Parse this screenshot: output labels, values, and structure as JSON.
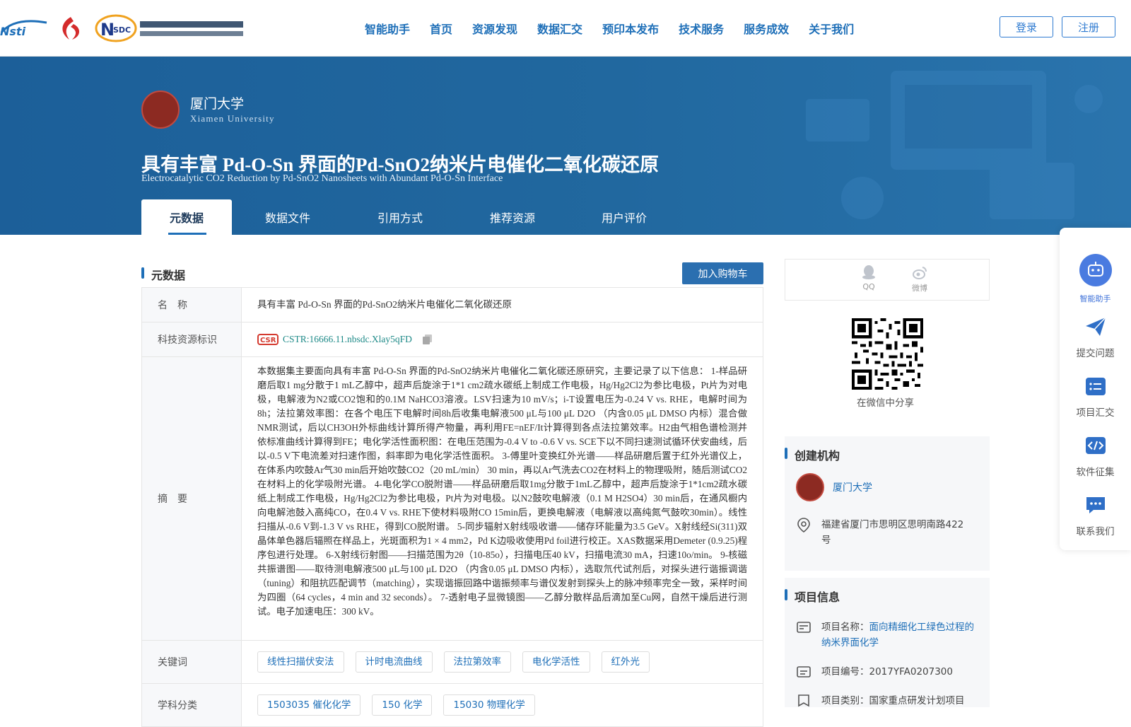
{
  "nav": {
    "items": [
      "智能助手",
      "首页",
      "资源发现",
      "数据汇交",
      "预印本发布",
      "技术服务",
      "服务成效",
      "关于我们"
    ],
    "login": "登录",
    "register": "注册"
  },
  "banner": {
    "institution": "厦门大学",
    "institution_en": "Xiamen University",
    "title": "具有丰富 Pd-O-Sn 界面的Pd-SnO2纳米片电催化二氧化碳还原",
    "subtitle": "Electrocatalytic CO2 Reduction by Pd-SnO2 Nanosheets with Abundant Pd-O-Sn Interface",
    "tabs": [
      "元数据",
      "数据文件",
      "引用方式",
      "推荐资源",
      "用户评价"
    ]
  },
  "metadata": {
    "heading": "元数据",
    "cart_button": "加入购物车",
    "name_label": "名　称",
    "name_value": "具有丰富 Pd-O-Sn 界面的Pd-SnO2纳米片电催化二氧化碳还原",
    "id_label": "科技资源标识",
    "cstr": "CSTR:16666.11.nbsdc.Xlay5qFD",
    "abstract_label": "摘　要",
    "abstract": "本数据集主要面向具有丰富 Pd-O-Sn 界面的Pd-SnO2纳米片电催化二氧化碳还原研究，主要记录了以下信息： 1-样品研磨后取1 mg分散于1 mL乙醇中，超声后旋涂于1*1 cm2疏水碳纸上制成工作电极，Hg/Hg2Cl2为参比电极，Pt片为对电极，电解液为N2或CO2饱和的0.1M NaHCO3溶液。LSV扫速为10 mV/s；i-T设置电压为-0.24 V vs. RHE，电解时间为8h；法拉第效率图：在各个电压下电解时间8h后收集电解液500 μL与100 μL D2O （内含0.05 μL DMSO 内标）混合做NMR测试，后以CH3OH外标曲线计算所得产物量，再利用FE=nEF/It计算得到各点法拉第效率。H2由气相色谱检测并依标准曲线计算得到FE；电化学活性面积图：在电压范围为-0.4 V to -0.6 V vs. SCE下以不同扫速测试循环伏安曲线，后以-0.5 V下电流差对扫速作图，斜率即为电化学活性面积。 3-傅里叶变换红外光谱——样品研磨后置于红外光谱仪上，在体系内吹鼓Ar气30 min后开始吹鼓CO2（20 mL/min） 30 min，再以Ar气洗去CO2在材料上的物理吸附，随后测试CO2在材料上的化学吸附光谱。 4-电化学CO脱附谱——样品研磨后取1mg分散于1mL乙醇中，超声后旋涂于1*1cm2疏水碳纸上制成工作电极，Hg/Hg2Cl2为参比电极，Pt片为对电极。以N2鼓吹电解液（0.1 M H2SO4）30 min后，在通风橱内向电解池鼓入高纯CO，在0.4 V vs. RHE下使材料吸附CO 15min后，更换电解液（电解液以高纯氮气鼓吹30min）。线性扫描从-0.6 V到-1.3 V vs RHE，得到CO脱附谱。 5-同步辐射X射线吸收谱——储存环能量为3.5 GeV。X射线经Si(311)双晶体单色器后辐照在样品上，光斑面积为1 × 4 mm2，Pd K边吸收使用Pd foil进行校正。XAS数据采用Demeter (0.9.25)程序包进行处理。 6-X射线衍射图——扫描范围为2θ（10-85o），扫描电压40 kV，扫描电流30 mA，扫速10o/min。 9-核磁共振谱图——取待测电解液500 μL与100 μL D2O （内含0.05 μL DMSO 内标），选取氘代试剂后，对探头进行谐振调谐（tuning）和阻抗匹配调节（matching），实现谐振回路中谐振频率与谱仪发射到探头上的脉冲频率完全一致，采样时间为四圈（64 cycles，4 min and 32 seconds）。 7-透射电子显微镜图——乙醇分散样品后滴加至Cu网，自然干燥后进行测试。电子加速电压：300 kV。",
    "keywords_label": "关键词",
    "keywords": [
      "线性扫描伏安法",
      "计时电流曲线",
      "法拉第效率",
      "电化学活性",
      "红外光"
    ],
    "subject_label": "学科分类",
    "subjects": [
      "1503035 催化化学",
      "150 化学",
      "15030 物理化学"
    ]
  },
  "share": {
    "qq": "QQ",
    "weibo": "微博",
    "wechat_caption": "在微信中分享"
  },
  "creator": {
    "heading": "创建机构",
    "name": "厦门大学",
    "address": "福建省厦门市思明区思明南路422号"
  },
  "project": {
    "heading": "项目信息",
    "name_label": "项目名称：",
    "name_value": "面向精细化工绿色过程的纳米界面化学",
    "number_label": "项目编号：",
    "number_value": "2017YFA0207300",
    "type_label": "项目类别：",
    "type_value": "国家重点研发计划项目"
  },
  "float_bar": [
    "智能助手",
    "提交问题",
    "项目汇交",
    "软件征集",
    "联系我们"
  ],
  "colors": {
    "brand_blue": "#1e6fb8",
    "banner": "#1c5f99",
    "cstr_teal": "#1e8a88",
    "float_accent": "#3b6fd8"
  }
}
